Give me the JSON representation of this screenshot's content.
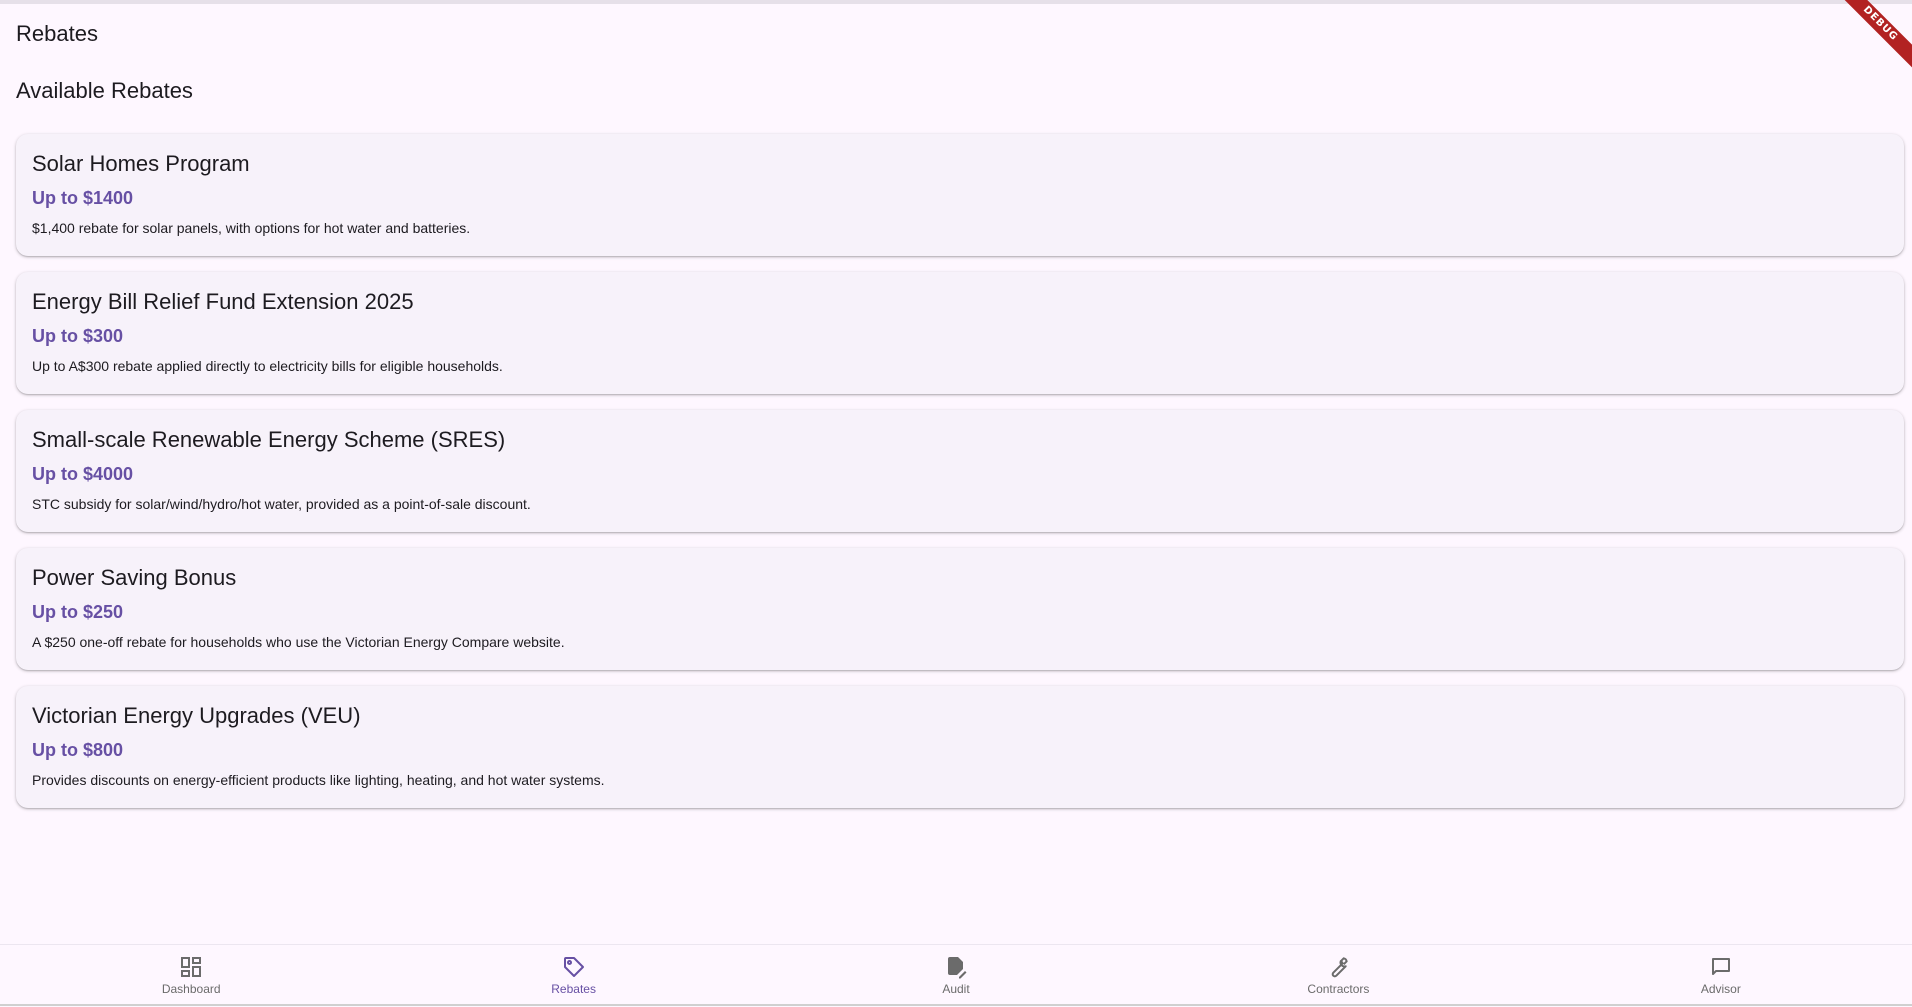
{
  "app_bar": {
    "title": "Rebates"
  },
  "debug_banner": "DEBUG",
  "section": {
    "title": "Available Rebates"
  },
  "rebates": [
    {
      "title": "Solar Homes Program",
      "amount": "Up to $1400",
      "description": "$1,400 rebate for solar panels, with options for hot water and batteries."
    },
    {
      "title": "Energy Bill Relief Fund Extension 2025",
      "amount": "Up to $300",
      "description": "Up to A$300 rebate applied directly to electricity bills for eligible households."
    },
    {
      "title": "Small-scale Renewable Energy Scheme (SRES)",
      "amount": "Up to $4000",
      "description": "STC subsidy for solar/wind/hydro/hot water, provided as a point-of-sale discount."
    },
    {
      "title": "Power Saving Bonus",
      "amount": "Up to $250",
      "description": "A $250 one-off rebate for households who use the Victorian Energy Compare website."
    },
    {
      "title": "Victorian Energy Upgrades (VEU)",
      "amount": "Up to $800",
      "description": "Provides discounts on energy-efficient products like lighting, heating, and hot water systems."
    }
  ],
  "bottom_nav": {
    "items": [
      {
        "label": "Dashboard",
        "icon": "dashboard-icon"
      },
      {
        "label": "Rebates",
        "icon": "tag-icon",
        "active": true
      },
      {
        "label": "Audit",
        "icon": "edit-document-icon"
      },
      {
        "label": "Contractors",
        "icon": "wrench-icon"
      },
      {
        "label": "Advisor",
        "icon": "chat-icon"
      }
    ]
  },
  "colors": {
    "background": "#fef7ff",
    "card": "#f7f2fa",
    "accent": "#6750a4",
    "inactive": "#6b6b6b"
  }
}
